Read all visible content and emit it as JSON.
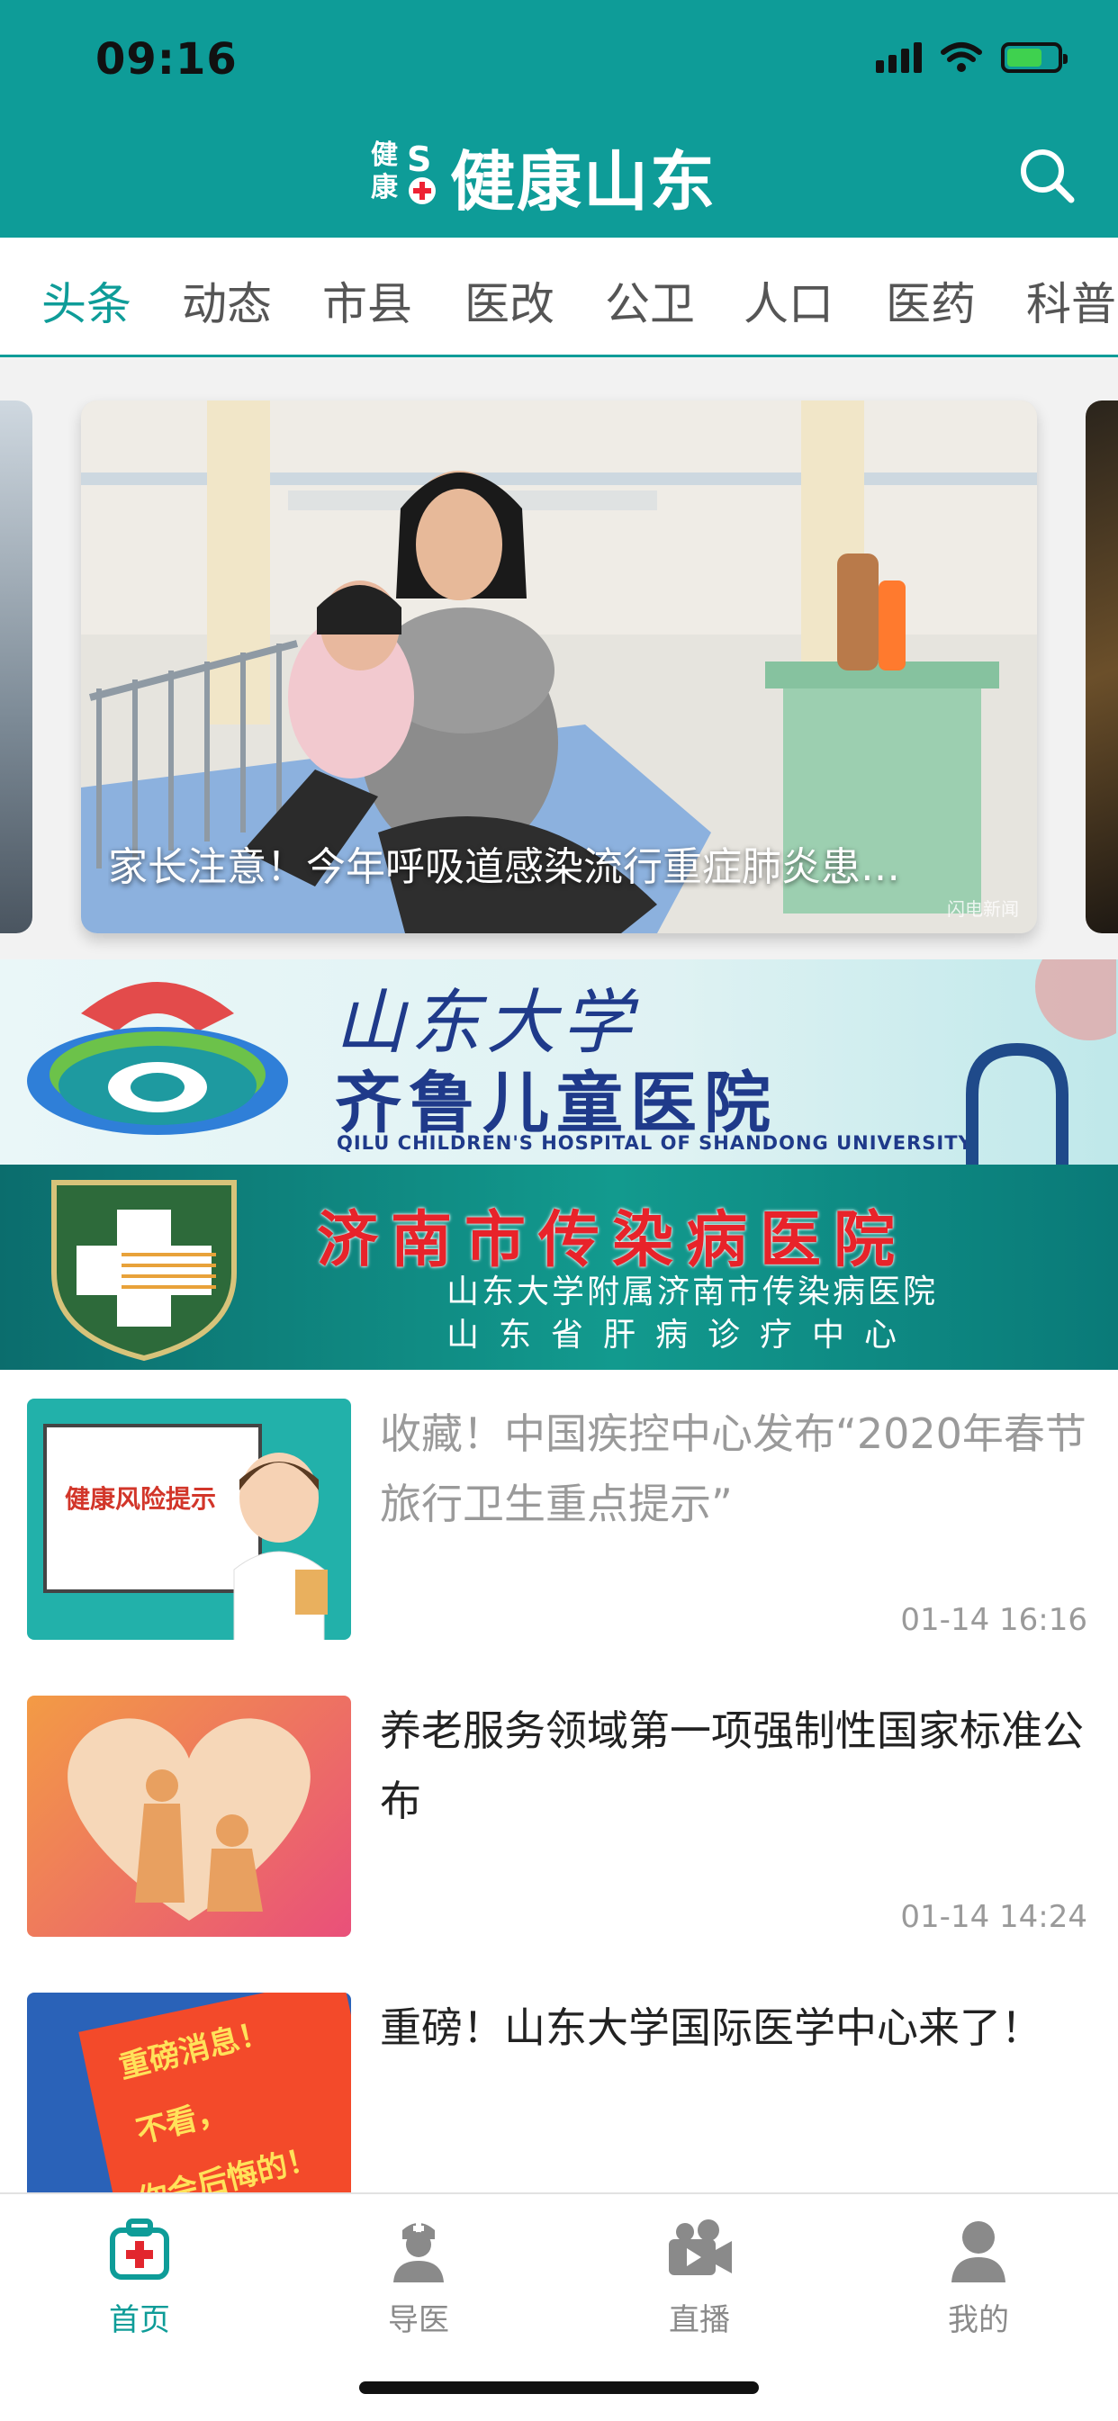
{
  "status_bar": {
    "time": "09:16",
    "battery_level": 0.7
  },
  "header": {
    "logo_mark_1": "健康",
    "logo_mark_2": "S",
    "app_title": "健康山东",
    "search_icon": "search-icon",
    "bg_color": "#0e9c98"
  },
  "tabs": [
    {
      "label": "头条",
      "active": true
    },
    {
      "label": "动态"
    },
    {
      "label": "市县"
    },
    {
      "label": "医改"
    },
    {
      "label": "公卫"
    },
    {
      "label": "人口"
    },
    {
      "label": "医药"
    },
    {
      "label": "科普"
    }
  ],
  "carousel": {
    "caption": "家长注意！今年呼吸道感染流行重症肺炎患…",
    "watermark": "闪电新闻"
  },
  "banners": [
    {
      "script_title": "山东大学",
      "name": "齐鲁儿童医院",
      "english": "QILU CHILDREN'S HOSPITAL OF SHANDONG UNIVERSITY"
    },
    {
      "title": "济南市传染病医院",
      "sub1": "山东大学附属济南市传染病医院",
      "sub2": "山东省肝病诊疗中心"
    }
  ],
  "news": [
    {
      "title": "收藏！中国疾控中心发布“2020年春节旅行卫生重点提示”",
      "time": "01-14 16:16",
      "thumb_text": "健康风险提示",
      "read": true
    },
    {
      "title": "养老服务领域第一项强制性国家标准公布",
      "time": "01-14 14:24",
      "read": false
    },
    {
      "title": "重磅！山东大学国际医学中心来了！",
      "thumb_lines": [
        "重磅消息！",
        "不看，",
        "你会后悔的！"
      ],
      "read": false
    }
  ],
  "tabbar": [
    {
      "label": "首页",
      "icon": "medical-kit-icon",
      "active": true
    },
    {
      "label": "导医",
      "icon": "nurse-icon"
    },
    {
      "label": "直播",
      "icon": "video-camera-icon"
    },
    {
      "label": "我的",
      "icon": "user-icon"
    }
  ]
}
